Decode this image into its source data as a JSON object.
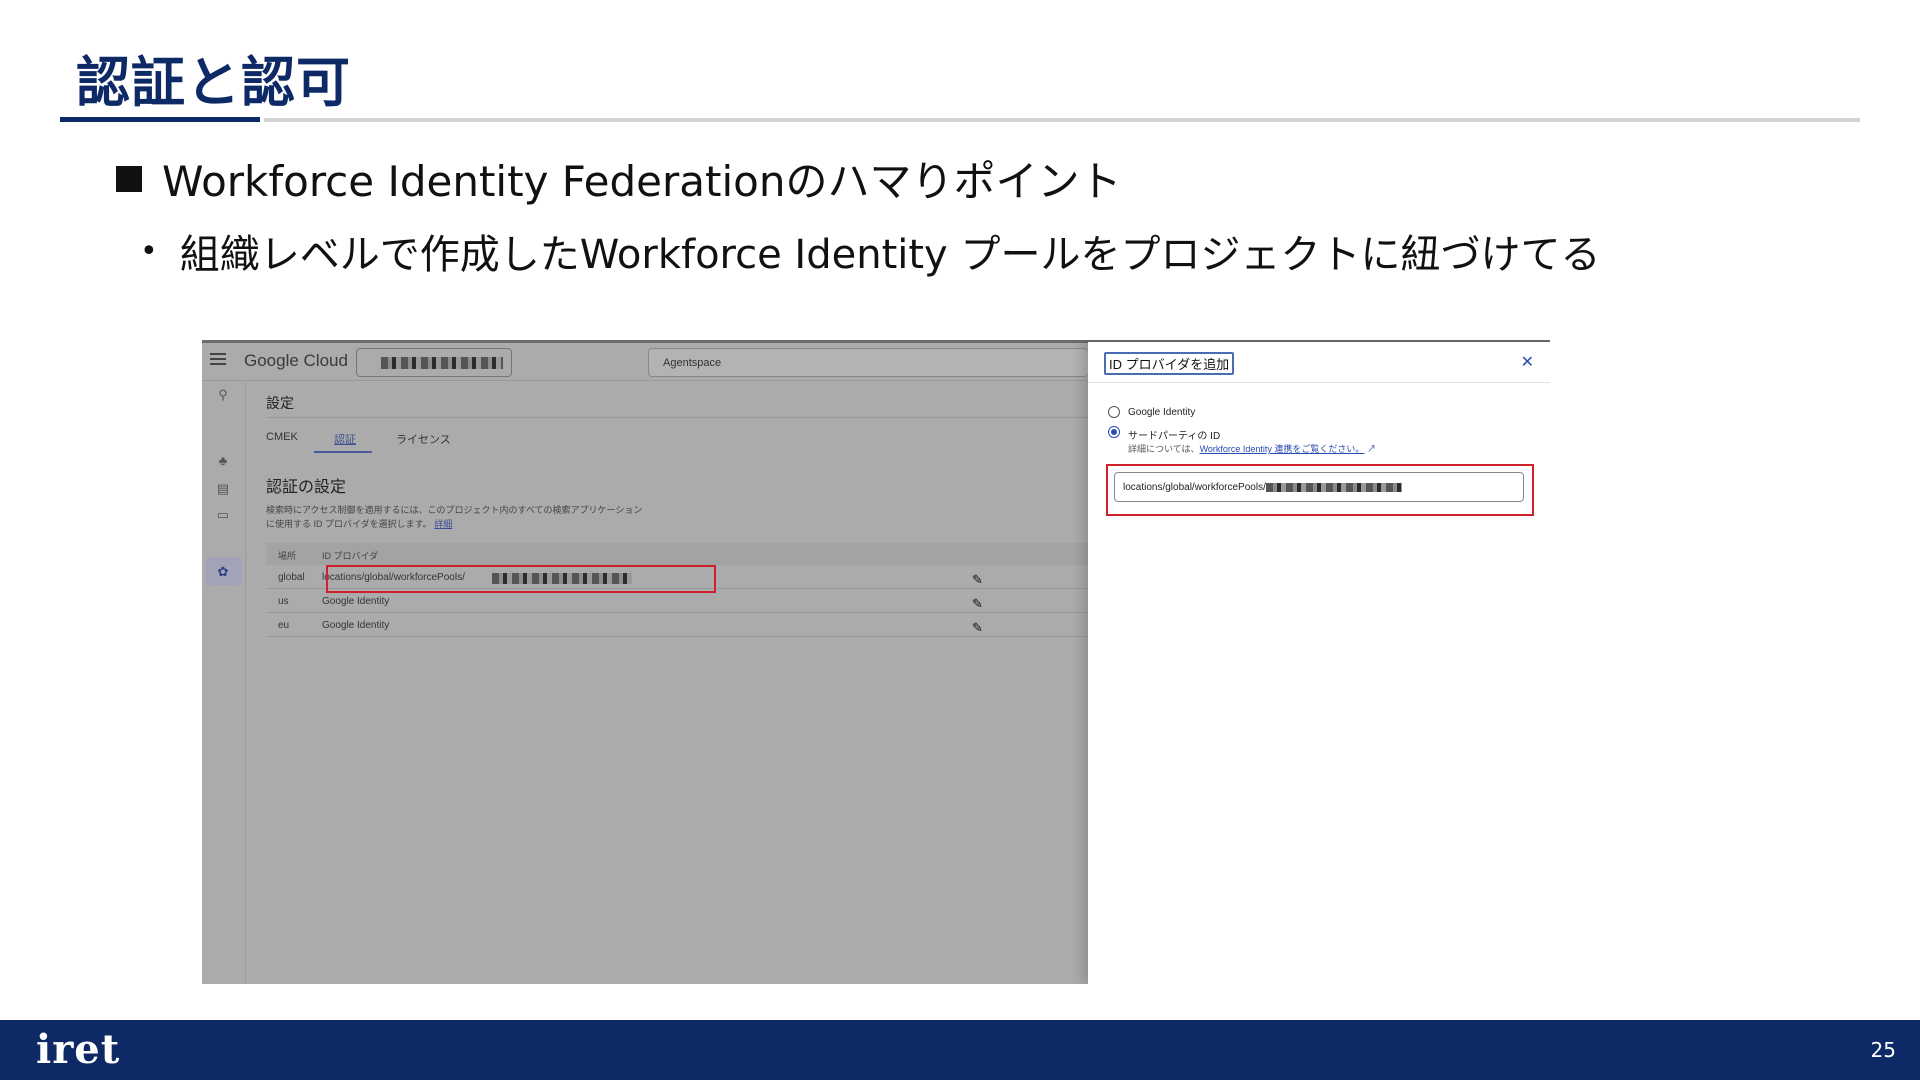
{
  "slide": {
    "title": "認証と認可",
    "bullet1": "Workforce Identity Federationのハマりポイント",
    "bullet2": "組織レベルで作成したWorkforce Identity プールをプロジェクトに紐づけてる",
    "page_number": "25",
    "logo_text": "iret"
  },
  "console": {
    "brand": "Google Cloud",
    "search_text": "Agentspace",
    "page_heading": "設定",
    "tabs": [
      "CMEK",
      "認証",
      "ライセンス"
    ],
    "section_title": "認証の設定",
    "description_line1": "検索時にアクセス制御を適用するには、このプロジェクト内のすべての検索アプリケーション",
    "description_line2": "に使用する ID プロバイダを選択します。",
    "description_link": "詳細",
    "table_headers": [
      "場所",
      "ID プロバイダ"
    ],
    "rows": [
      {
        "location": "global",
        "provider": "locations/global/workforcePools/"
      },
      {
        "location": "us",
        "provider": "Google Identity"
      },
      {
        "location": "eu",
        "provider": "Google Identity"
      }
    ]
  },
  "panel": {
    "title": "ID プロバイダを追加",
    "option_google": "Google Identity",
    "option_third_party": "サードパーティの ID",
    "hint_prefix": "詳細については、",
    "hint_link": "Workforce Identity 連携をご覧ください。",
    "field_value": "locations/global/workforcePools/"
  },
  "colors": {
    "brand_navy": "#0e2a66",
    "highlight_red": "#d0202b",
    "link_blue": "#2a4db3"
  }
}
